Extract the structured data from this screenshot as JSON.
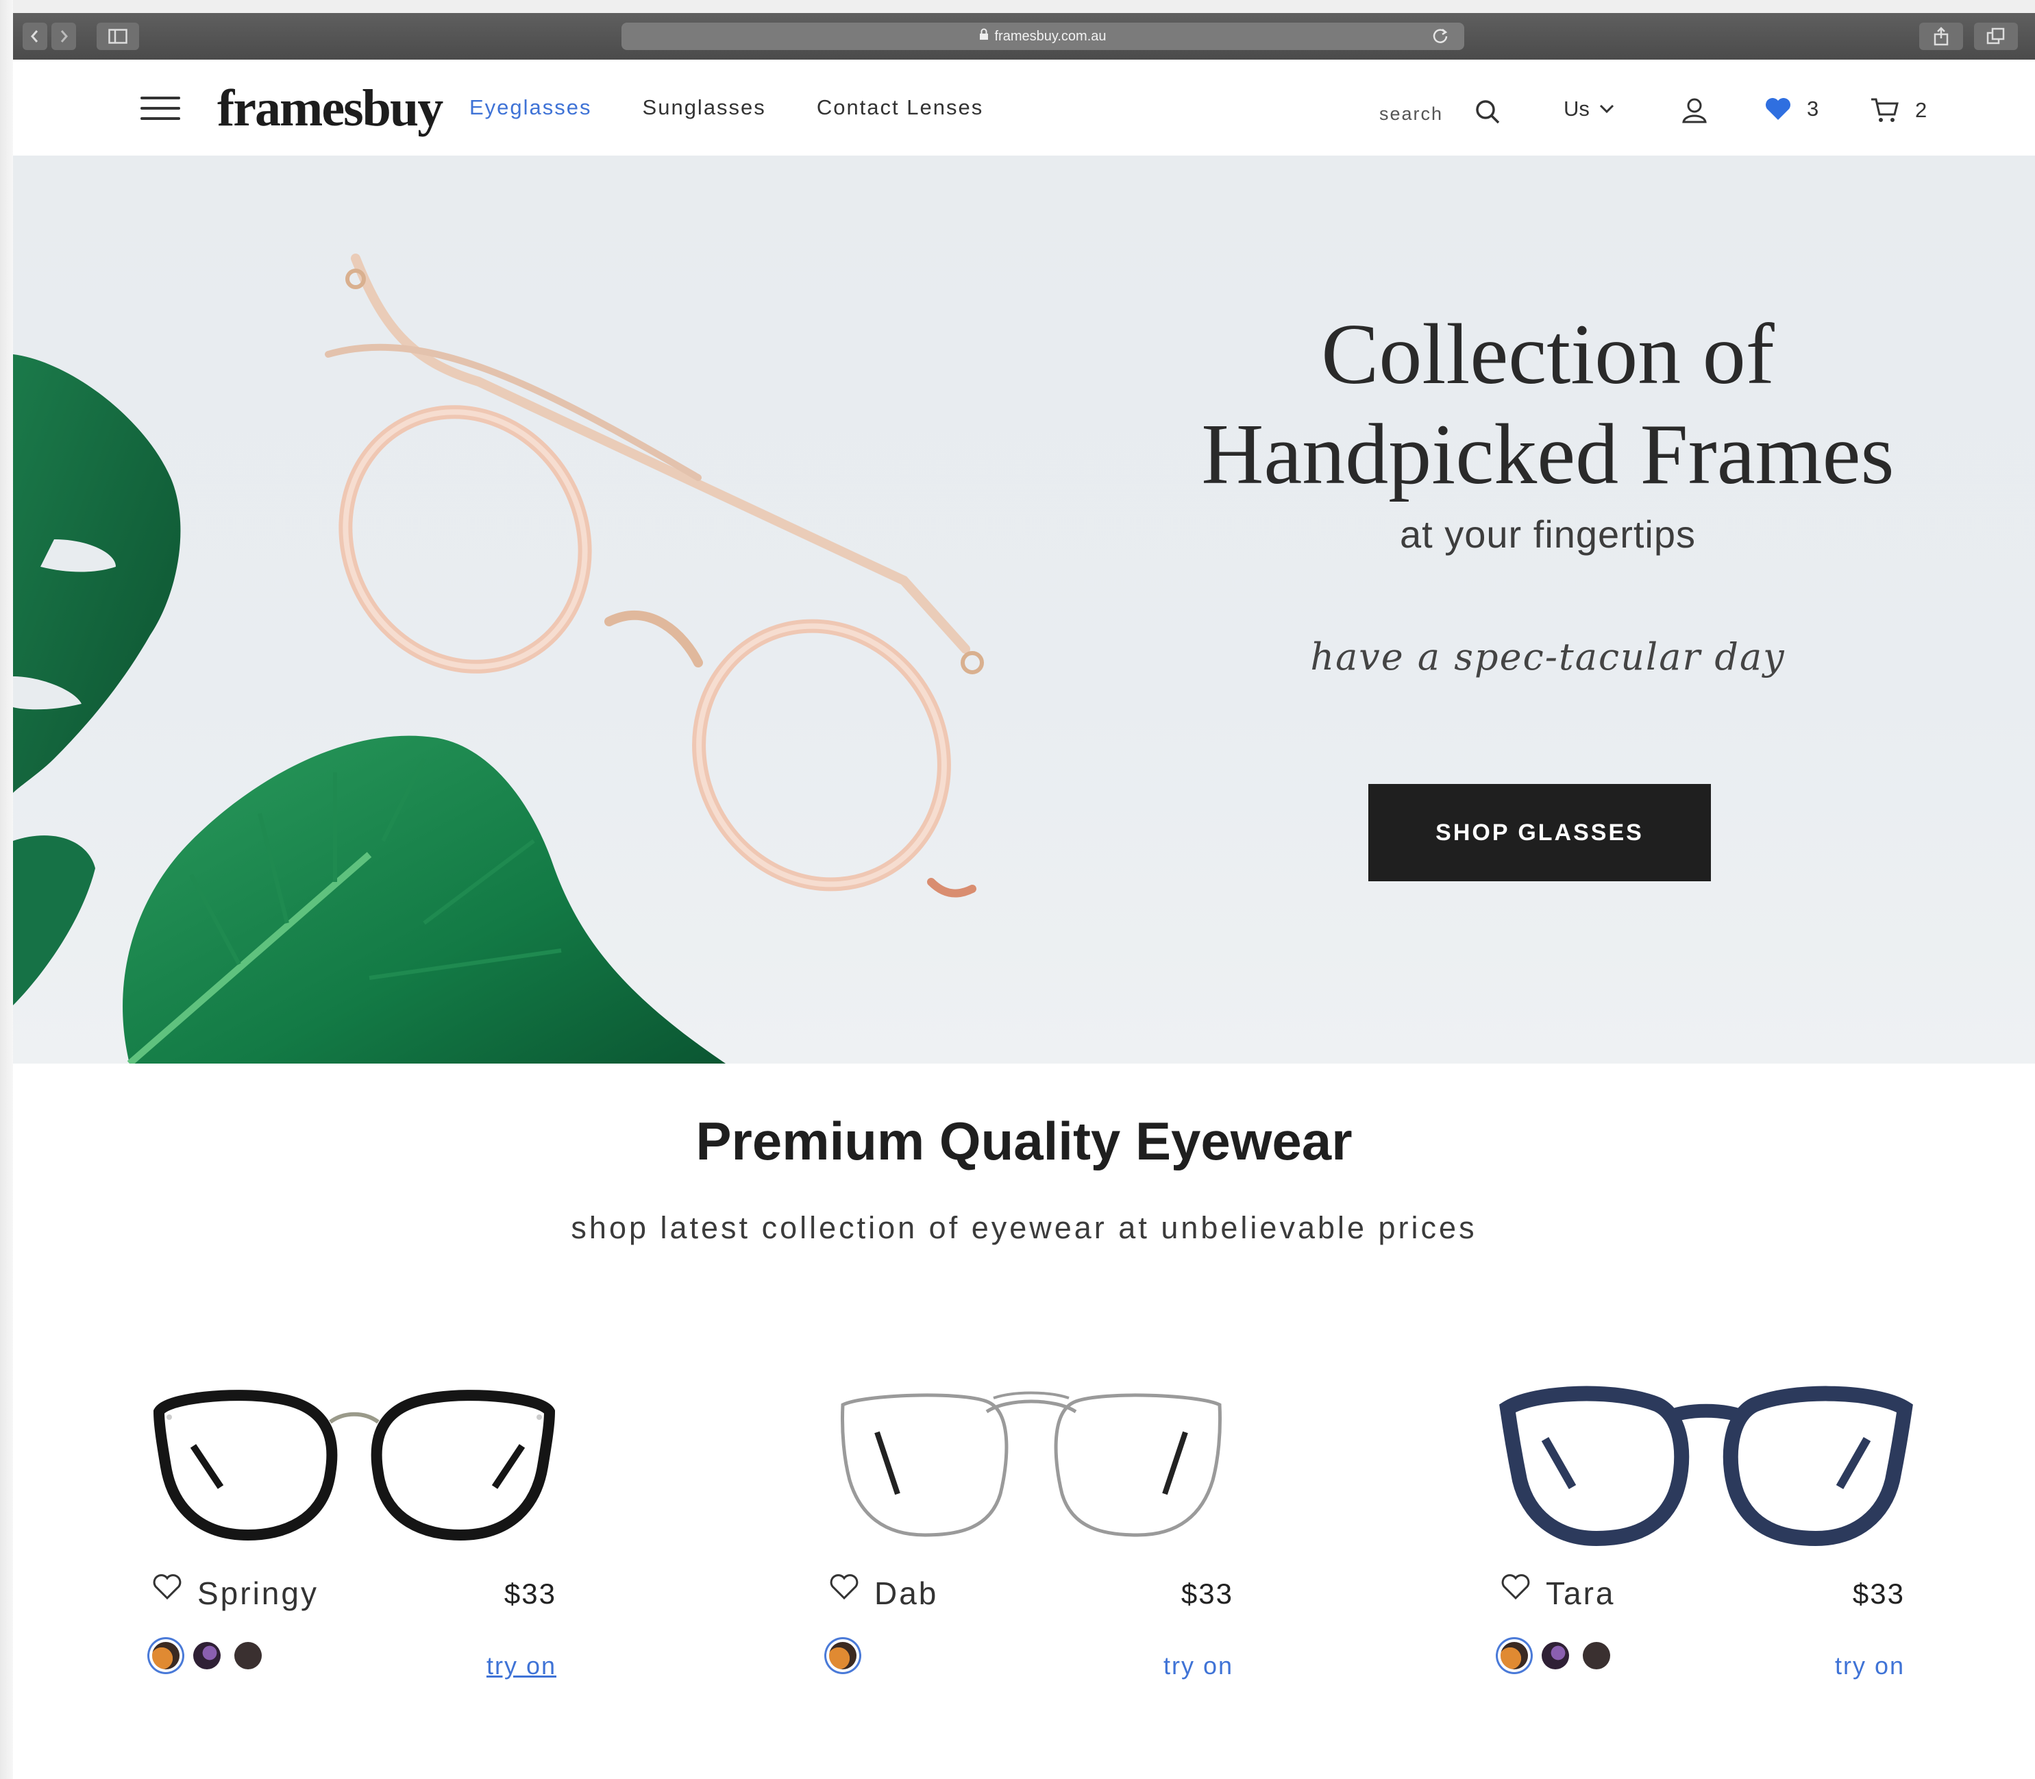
{
  "browser": {
    "url": "framesbuy.com.au"
  },
  "header": {
    "logo": "framesbuy",
    "nav": [
      "Eyeglasses",
      "Sunglasses",
      "Contact Lenses"
    ],
    "search_label": "search",
    "region": "Us",
    "wishlist_count": "3",
    "cart_count": "2"
  },
  "hero": {
    "title_line1": "Collection of",
    "title_line2": "Handpicked Frames",
    "subtitle": "at your fingertips",
    "tagline": "have a spec-tacular day",
    "cta": "SHOP GLASSES"
  },
  "section": {
    "title": "Premium Quality Eyewear",
    "subtitle": "shop latest collection of eyewear at unbelievable prices"
  },
  "products": [
    {
      "name": "Springy",
      "price": "$33",
      "try_on": "try on",
      "swatches": [
        "#d9792a",
        "#5b3b75",
        "#3a3030"
      ]
    },
    {
      "name": "Dab",
      "price": "$33",
      "try_on": "try on",
      "swatches": [
        "#d9792a"
      ]
    },
    {
      "name": "Tara",
      "price": "$33",
      "try_on": "try on",
      "swatches": [
        "#d9792a",
        "#5b3b75",
        "#3a3030"
      ]
    }
  ],
  "colors": {
    "accent": "#3f73d6",
    "button": "#1f1f1f",
    "wishlist_heart": "#2f6fe0"
  }
}
